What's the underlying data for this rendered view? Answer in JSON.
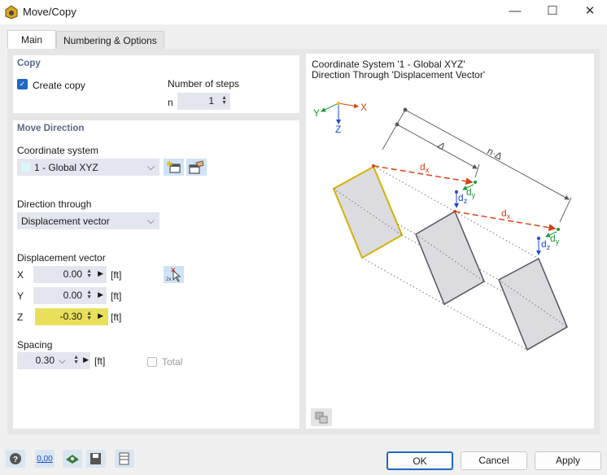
{
  "window": {
    "title": "Move/Copy",
    "minimize": "—",
    "maximize": "☐",
    "close": "✕"
  },
  "tabs": [
    {
      "label": "Main"
    },
    {
      "label": "Numbering & Options"
    }
  ],
  "copy": {
    "section": "Copy",
    "create_copy_label": "Create copy",
    "create_copy_checked": true,
    "steps_label": "Number of steps",
    "n_label": "n",
    "n_value": "1"
  },
  "move": {
    "section": "Move Direction",
    "coord_label": "Coordinate system",
    "coord_value": "1 - Global XYZ",
    "coord_color": "#d8f8fa",
    "direction_label": "Direction through",
    "direction_value": "Displacement vector",
    "vector_label": "Displacement vector",
    "vector": [
      {
        "axis": "X",
        "value": "0.00",
        "unit": "[ft]"
      },
      {
        "axis": "Y",
        "value": "0.00",
        "unit": "[ft]"
      },
      {
        "axis": "Z",
        "value": "-0.30",
        "unit": "[ft]"
      }
    ],
    "spacing_label": "Spacing",
    "spacing_value": "0.30",
    "spacing_unit": "[ft]",
    "total_label": "Total"
  },
  "diagram": {
    "line1": "Coordinate System '1 - Global XYZ'",
    "line2": "Direction Through 'Displacement Vector'",
    "labels": {
      "x": "X",
      "y": "Y",
      "z": "Z",
      "delta": "Δ",
      "ndelta": "n·Δ",
      "dx": "d",
      "dy": "d",
      "dz": "d",
      "sx": "x",
      "sy": "y",
      "sz": "z"
    }
  },
  "buttons": {
    "ok": "OK",
    "cancel": "Cancel",
    "apply": "Apply"
  },
  "footer_icons": {
    "units": "0,00"
  }
}
